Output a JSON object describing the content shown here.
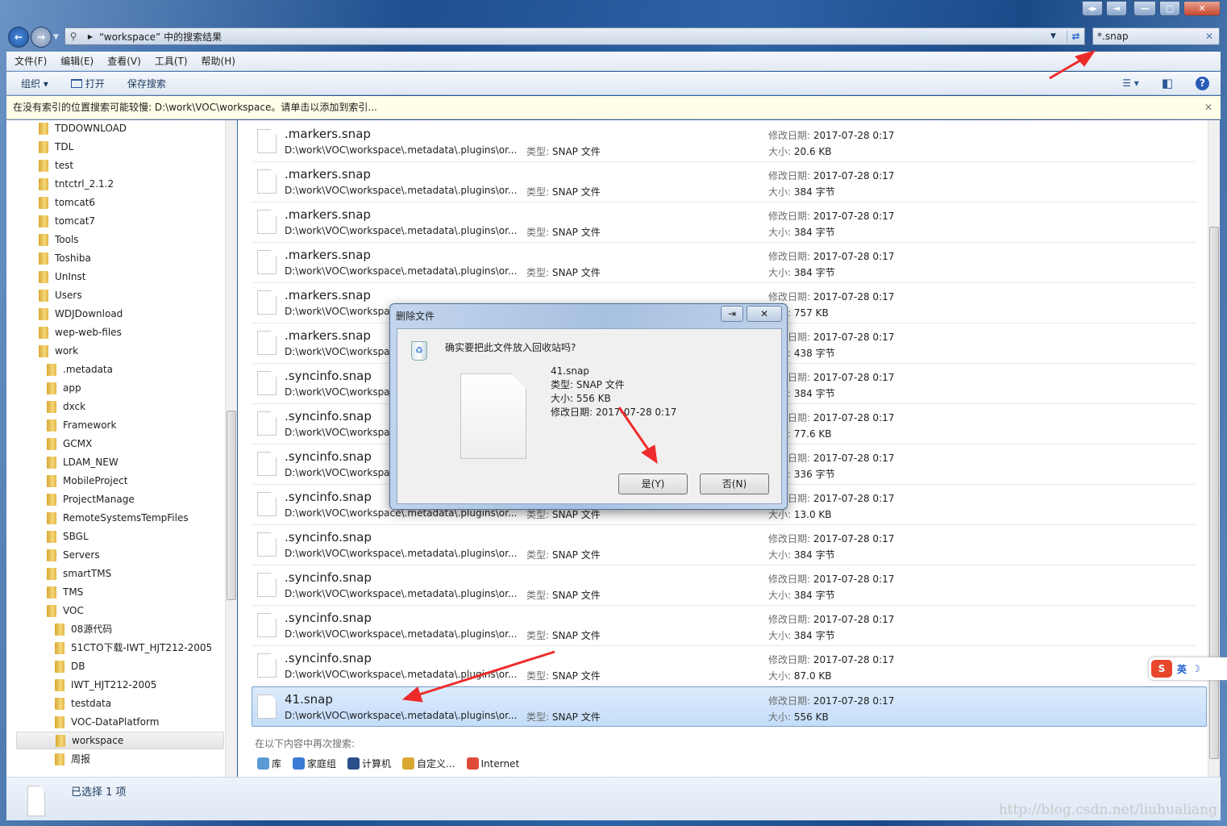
{
  "window": {
    "address": "“workspace” 中的搜索结果",
    "search_value": "*.snap",
    "caption_buttons": [
      "◂▸",
      "⇥",
      "—",
      "▢",
      "✕"
    ]
  },
  "menu": [
    "文件(F)",
    "编辑(E)",
    "查看(V)",
    "工具(T)",
    "帮助(H)"
  ],
  "toolbar": {
    "organize": "组织 ▾",
    "open": "打开",
    "save_search": "保存搜索"
  },
  "infobar": {
    "text": "在没有索引的位置搜索可能较慢: D:\\work\\VOC\\workspace。请单击以添加到索引...",
    "close": "✕"
  },
  "tree": [
    {
      "label": "TDDOWNLOAD",
      "level": 0
    },
    {
      "label": "TDL",
      "level": 0
    },
    {
      "label": "test",
      "level": 0
    },
    {
      "label": "tntctrl_2.1.2",
      "level": 0
    },
    {
      "label": "tomcat6",
      "level": 0
    },
    {
      "label": "tomcat7",
      "level": 0
    },
    {
      "label": "Tools",
      "level": 0
    },
    {
      "label": "Toshiba",
      "level": 0
    },
    {
      "label": "UnInst",
      "level": 0
    },
    {
      "label": "Users",
      "level": 0
    },
    {
      "label": "WDJDownload",
      "level": 0
    },
    {
      "label": "wep-web-files",
      "level": 0
    },
    {
      "label": "work",
      "level": 0
    },
    {
      "label": ".metadata",
      "level": 1
    },
    {
      "label": "app",
      "level": 1
    },
    {
      "label": "dxck",
      "level": 1
    },
    {
      "label": "Framework",
      "level": 1
    },
    {
      "label": "GCMX",
      "level": 1
    },
    {
      "label": "LDAM_NEW",
      "level": 1
    },
    {
      "label": "MobileProject",
      "level": 1
    },
    {
      "label": "ProjectManage",
      "level": 1
    },
    {
      "label": "RemoteSystemsTempFiles",
      "level": 1
    },
    {
      "label": "SBGL",
      "level": 1
    },
    {
      "label": "Servers",
      "level": 1
    },
    {
      "label": "smartTMS",
      "level": 1
    },
    {
      "label": "TMS",
      "level": 1
    },
    {
      "label": "VOC",
      "level": 1
    },
    {
      "label": "08源代码",
      "level": 2
    },
    {
      "label": "51CTO下载-IWT_HJT212-2005",
      "level": 2
    },
    {
      "label": "DB",
      "level": 2
    },
    {
      "label": "IWT_HJT212-2005",
      "level": 2
    },
    {
      "label": "testdata",
      "level": 2
    },
    {
      "label": "VOC-DataPlatform",
      "level": 2
    },
    {
      "label": "workspace",
      "level": 2,
      "selected": true
    },
    {
      "label": "周报",
      "level": 2
    }
  ],
  "results": {
    "path": "D:\\work\\VOC\\workspace\\.metadata\\.plugins\\or...",
    "type_label": "类型:",
    "type": "SNAP 文件",
    "date_label": "修改日期:",
    "size_label": "大小:",
    "items": [
      {
        "name": ".markers.snap",
        "date": "2017-07-28 0:17",
        "size": "20.6 KB"
      },
      {
        "name": ".markers.snap",
        "date": "2017-07-28 0:17",
        "size": "384 字节"
      },
      {
        "name": ".markers.snap",
        "date": "2017-07-28 0:17",
        "size": "384 字节"
      },
      {
        "name": ".markers.snap",
        "date": "2017-07-28 0:17",
        "size": "384 字节"
      },
      {
        "name": ".markers.snap",
        "date": "2017-07-28 0:17",
        "size": "757 KB"
      },
      {
        "name": ".markers.snap",
        "date": "2017-07-28 0:17",
        "size": "438 字节"
      },
      {
        "name": ".syncinfo.snap",
        "date": "2017-07-28 0:17",
        "size": "384 字节"
      },
      {
        "name": ".syncinfo.snap",
        "date": "2017-07-28 0:17",
        "size": "77.6 KB"
      },
      {
        "name": ".syncinfo.snap",
        "date": "2017-07-28 0:17",
        "size": "336 字节"
      },
      {
        "name": ".syncinfo.snap",
        "date": "2017-07-28 0:17",
        "size": "13.0 KB"
      },
      {
        "name": ".syncinfo.snap",
        "date": "2017-07-28 0:17",
        "size": "384 字节"
      },
      {
        "name": ".syncinfo.snap",
        "date": "2017-07-28 0:17",
        "size": "384 字节"
      },
      {
        "name": ".syncinfo.snap",
        "date": "2017-07-28 0:17",
        "size": "384 字节"
      },
      {
        "name": ".syncinfo.snap",
        "date": "2017-07-28 0:17",
        "size": "87.0 KB"
      },
      {
        "name": "41.snap",
        "date": "2017-07-28 0:17",
        "size": "556 KB",
        "selected": true
      }
    ]
  },
  "search_again": {
    "label": "在以下内容中再次搜索:",
    "items": [
      {
        "label": "库",
        "color": "#5b9bd5"
      },
      {
        "label": "家庭组",
        "color": "#3a7bd5"
      },
      {
        "label": "计算机",
        "color": "#2b4f8a"
      },
      {
        "label": "自定义...",
        "color": "#d9a830"
      },
      {
        "label": "Internet",
        "color": "#e04a3a"
      }
    ]
  },
  "status": {
    "text": "已选择 1 项"
  },
  "dialog": {
    "title": "删除文件",
    "question": "确实要把此文件放入回收站吗?",
    "file_name": "41.snap",
    "file_type": "类型: SNAP 文件",
    "file_size": "大小: 556 KB",
    "file_date": "修改日期: 2017-07-28 0:17",
    "yes": "是(Y)",
    "no": "否(N)"
  },
  "ime": {
    "label": "英"
  },
  "watermark": "http://blog.csdn.net/liuhualiang"
}
